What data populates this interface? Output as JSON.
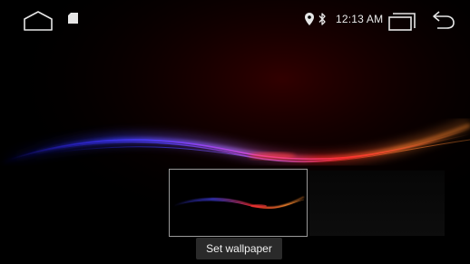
{
  "status_bar": {
    "time": "12:13 AM",
    "left_icons": [
      "home-icon",
      "sd-card-icon"
    ],
    "right_icons": [
      "location-icon",
      "bluetooth-icon",
      "recent-apps-icon",
      "back-icon"
    ]
  },
  "wallpaper_picker": {
    "selected_index": 0,
    "thumbnail_count": 2,
    "action_label": "Set wallpaper"
  },
  "colors": {
    "background": "#000000",
    "status_icon": "#e6e6e6",
    "wave_blue": "#3a3cff",
    "wave_red": "#ff2a2a",
    "wave_orange": "#ff8a2e",
    "button_bg": "#2c2c2c"
  }
}
